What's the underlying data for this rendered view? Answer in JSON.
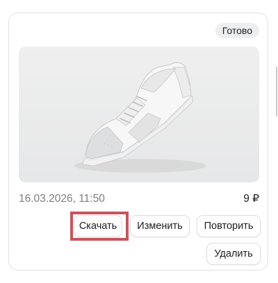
{
  "card": {
    "status": "Готово",
    "image": {
      "subject": "white-sneaker-product-photo"
    },
    "date": "16.03.2026, 11:50",
    "price": "9 ₽",
    "actions": {
      "download": "Скачать",
      "edit": "Изменить",
      "repeat": "Повторить",
      "delete": "Удалить"
    }
  },
  "colors": {
    "highlight": "#c8545e",
    "badge_bg": "#eceef0",
    "image_bg": "#ecedee"
  }
}
